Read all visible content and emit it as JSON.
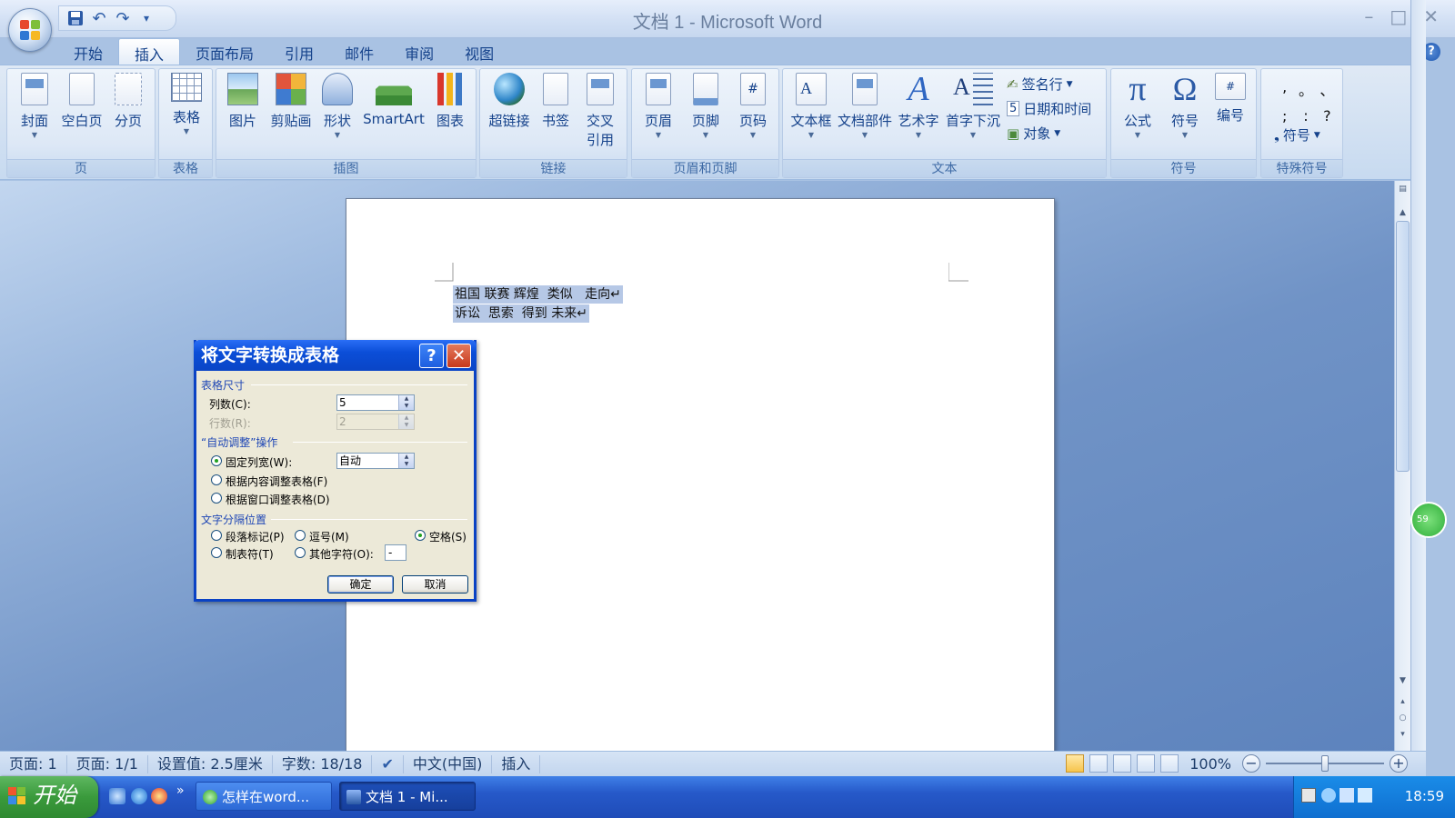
{
  "window": {
    "title": "文档 1 - Microsoft Word",
    "controls": {
      "minimize": "–",
      "maximize": "□",
      "close": "✕"
    }
  },
  "qat": {
    "icons": [
      "save-icon",
      "undo-icon",
      "redo-icon",
      "customize-icon"
    ],
    "more": "▾"
  },
  "tabs": [
    "开始",
    "插入",
    "页面布局",
    "引用",
    "邮件",
    "审阅",
    "视图"
  ],
  "active_tab": "插入",
  "ribbon": {
    "groups": {
      "page": {
        "label": "页",
        "buttons": [
          "封面",
          "空白页",
          "分页"
        ]
      },
      "table": {
        "label": "表格",
        "buttons": [
          "表格"
        ]
      },
      "illustrations": {
        "label": "插图",
        "buttons": [
          "图片",
          "剪贴画",
          "形状",
          "SmartArt",
          "图表"
        ]
      },
      "links": {
        "label": "链接",
        "buttons": [
          "超链接",
          "书签",
          "交叉",
          "引用"
        ]
      },
      "header_footer": {
        "label": "页眉和页脚",
        "buttons": [
          "页眉",
          "页脚",
          "页码"
        ]
      },
      "text": {
        "label": "文本",
        "buttons": [
          "文本框",
          "文档部件",
          "艺术字",
          "首字下沉"
        ],
        "small": [
          "签名行",
          "日期和时间",
          "对象"
        ]
      },
      "symbols": {
        "label": "符号",
        "buttons": [
          "公式",
          "符号",
          "编号"
        ]
      },
      "special": {
        "label": "特殊符号",
        "glyphs": [
          ",",
          "。",
          "、",
          ";",
          ":",
          "?"
        ],
        "button": "符号"
      }
    }
  },
  "document": {
    "lines": [
      "祖国 联赛 辉煌  类似   走向↵",
      "诉讼  思索  得到 未来↵"
    ]
  },
  "dialog": {
    "title": "将文字转换成表格",
    "help": "?",
    "close": "✕",
    "size_section": "表格尺寸",
    "columns_label": "列数(C):",
    "columns_value": "5",
    "rows_label": "行数(R):",
    "rows_value": "2",
    "autofit_section": "“自动调整”操作",
    "fixed_width_label": "固定列宽(W):",
    "fixed_width_value": "自动",
    "autofit_content": "根据内容调整表格(F)",
    "autofit_window": "根据窗口调整表格(D)",
    "separator_section": "文字分隔位置",
    "sep_paragraph": "段落标记(P)",
    "sep_comma": "逗号(M)",
    "sep_space": "空格(S)",
    "sep_tab": "制表符(T)",
    "sep_other": "其他字符(O):",
    "sep_other_value": "-",
    "ok": "确定",
    "cancel": "取消"
  },
  "statusbar": {
    "page": "页面: 1",
    "pages": "页面: 1/1",
    "setting": "设置值: 2.5厘米",
    "words": "字数: 18/18",
    "language": "中文(中国)",
    "mode": "插入",
    "zoom": "100%",
    "zoom_minus": "−",
    "zoom_plus": "+"
  },
  "taskbar": {
    "start": "开始",
    "tasks": [
      "怎样在word...",
      "文档 1 - Mi..."
    ],
    "clock": "18:59",
    "more": "»"
  },
  "side_badge": "59",
  "colors": {
    "dialog_title": "#0a45c6",
    "ribbon": "#dfe9f5",
    "start": "#3a9a3c",
    "taskbar": "#2659c9"
  }
}
